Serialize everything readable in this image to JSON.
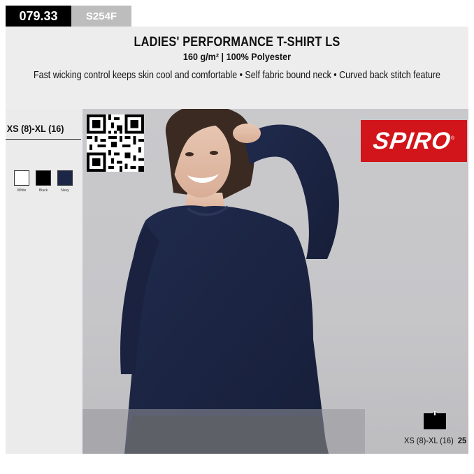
{
  "product": {
    "code": "079.33",
    "sku": "S254F",
    "title": "LADIES' PERFORMANCE T-SHIRT LS",
    "subtitle": "160 g/m² | 100% Polyester",
    "features": "Fast wicking control keeps skin cool and comfortable • Self fabric bound neck • Curved back stitch feature"
  },
  "sizes": {
    "range": "XS (8)-XL (16)"
  },
  "colors": [
    {
      "label": "White",
      "hex": "#ffffff"
    },
    {
      "label": "Black",
      "hex": "#000000"
    },
    {
      "label": "Navy",
      "hex": "#1c2748"
    }
  ],
  "brand": {
    "logo_text": "SPIRO",
    "logo_mark": "®",
    "logo_bg": "#d2151b"
  },
  "pack": {
    "size_range": "XS (8)-XL (16)",
    "quantity": "25",
    "icon": "carton-icon"
  },
  "qr": {
    "icon": "qr-code-icon"
  }
}
